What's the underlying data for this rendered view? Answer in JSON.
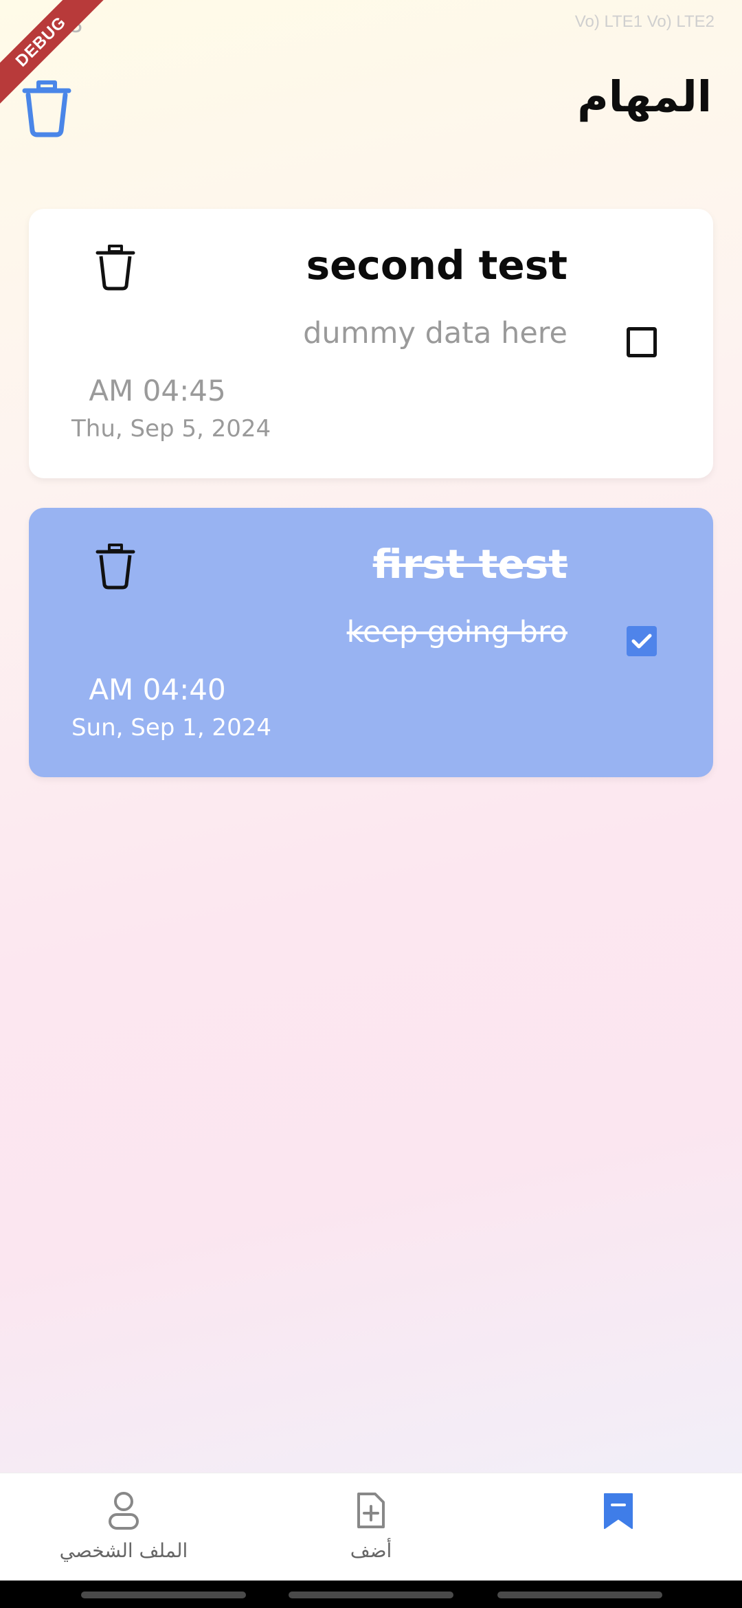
{
  "status_bar": {
    "time": "43",
    "icons_text": "Vo) LTE1 Vo) LTE2"
  },
  "debug_banner": "DEBUG",
  "header": {
    "title": "المهام",
    "delete_all_icon": "trash-icon"
  },
  "tasks": [
    {
      "title": "second test",
      "description": "dummy data here",
      "time": "AM 04:45",
      "date": "Thu, Sep 5, 2024",
      "completed": false,
      "card_color": "#ffffff"
    },
    {
      "title": "first test",
      "description": "keep going bro",
      "time": "AM 04:40",
      "date": "Sun, Sep 1, 2024",
      "completed": true,
      "card_color": "#98b3f2"
    }
  ],
  "bottom_nav": {
    "items": [
      {
        "label": "الملف الشخصي",
        "icon": "person-icon",
        "active": false
      },
      {
        "label": "أضف",
        "icon": "add-file-icon",
        "active": false
      },
      {
        "label": "",
        "icon": "bookmark-icon",
        "active": true
      }
    ]
  },
  "colors": {
    "accent": "#4f84ea",
    "completed_card": "#98b3f2",
    "title_text": "#0d0d0d"
  }
}
